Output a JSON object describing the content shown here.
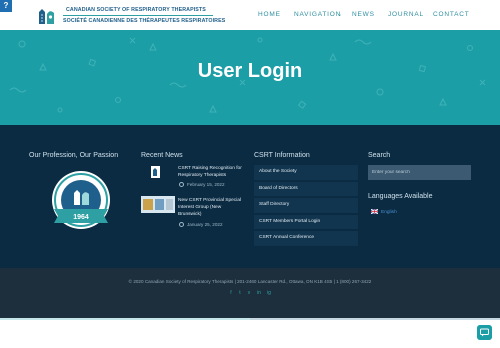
{
  "header": {
    "help_tab": "?",
    "org_name_en": "CANADIAN SOCIETY OF RESPIRATORY THERAPISTS",
    "org_name_fr": "SOCIÉTÉ CANADIENNE DES THÉRAPEUTES RESPIRATOIRES",
    "nav": {
      "home": "HOME",
      "navigation": "NAVIGATION",
      "navigation_caret": "⌄",
      "news": "NEWS",
      "journal": "JOURNAL",
      "contact": "CONTACT"
    }
  },
  "hero": {
    "title": "User Login"
  },
  "footer": {
    "col1": {
      "title": "Our Profession, Our Passion",
      "seal_year": "1964"
    },
    "col2": {
      "title": "Recent News",
      "items": [
        {
          "title": "CSRT Raising Recognition for Respiratory Therapists",
          "date": "February 15, 2022"
        },
        {
          "title": "New CSRT Provincial Special Interest Group (New Brunswick)",
          "date": "January 25, 2022"
        }
      ]
    },
    "col3": {
      "title": "CSRT Information",
      "items": [
        "About the Society",
        "Board of Directors",
        "Staff Directory",
        "CSRT Members Portal Login",
        "CSRT Annual Conference"
      ]
    },
    "col4": {
      "title": "Search",
      "search_placeholder": "Enter your search",
      "languages_title": "Languages Available",
      "language": "English"
    }
  },
  "bottom": {
    "copyright": "© 2020 Canadian Society of Respiratory Therapists   |   201-2460 Lancaster Rd., Ottawa, ON K1B 4S5   |   1 (800) 267-3422",
    "socials": [
      "f",
      "t",
      "v",
      "in",
      "ig"
    ]
  },
  "colors": {
    "hero_teal": "#1c9ea6",
    "footer_navy": "#0b2b43",
    "bottom_bar": "#1d2f3d",
    "nav_text": "#2e8fa0"
  }
}
